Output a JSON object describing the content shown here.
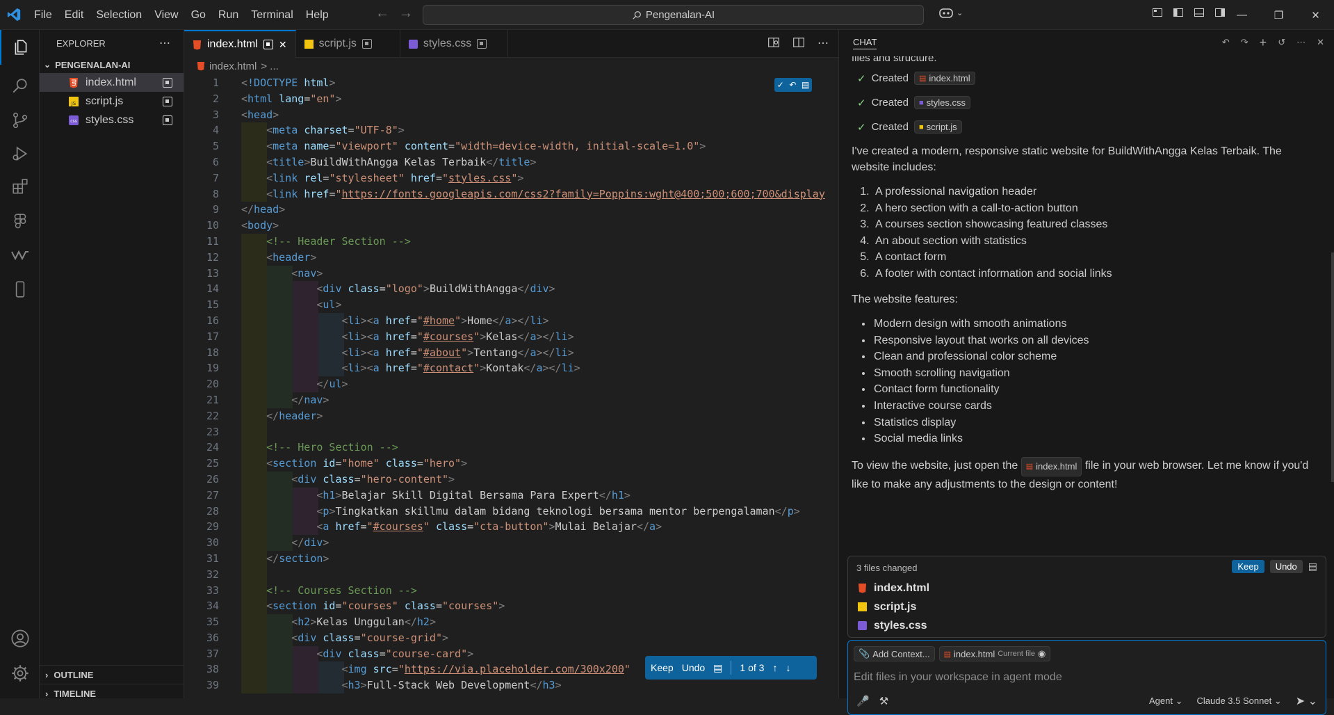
{
  "menu": [
    "File",
    "Edit",
    "Selection",
    "View",
    "Go",
    "Run",
    "Terminal",
    "Help"
  ],
  "search": {
    "text": "Pengenalan-AI"
  },
  "sidebar": {
    "title": "EXPLORER",
    "folder": "PENGENALAN-AI",
    "files": [
      {
        "name": "index.html",
        "icon": "html-file-icon"
      },
      {
        "name": "script.js",
        "icon": "js-file-icon"
      },
      {
        "name": "styles.css",
        "icon": "css-file-icon"
      }
    ],
    "outline": "OUTLINE",
    "timeline": "TIMELINE"
  },
  "tabs": [
    "index.html",
    "script.js",
    "styles.css"
  ],
  "breadcrumb": {
    "file": "index.html",
    "rest": "> ..."
  },
  "review": {
    "keep": "Keep",
    "undo": "Undo",
    "count": "1 of 3"
  },
  "chat": {
    "title": "CHAT",
    "fragment": "files and structure.",
    "created_label": "Created",
    "created_files": [
      "index.html",
      "styles.css",
      "script.js"
    ],
    "intro": "I've created a modern, responsive static website for BuildWithAngga Kelas Terbaik. The website includes:",
    "includes": [
      "A professional navigation header",
      "A hero section with a call-to-action button",
      "A courses section showcasing featured classes",
      "An about section with statistics",
      "A contact form",
      "A footer with contact information and social links"
    ],
    "features_title": "The website features:",
    "features": [
      "Modern design with smooth animations",
      "Responsive layout that works on all devices",
      "Clean and professional color scheme",
      "Smooth scrolling navigation",
      "Contact form functionality",
      "Interactive course cards",
      "Statistics display",
      "Social media links"
    ],
    "view_before": "To view the website, just open the",
    "view_chip": "index.html",
    "view_after": "file in your web browser. Let me know if you'd like to make any adjustments to the design or content!",
    "changed": {
      "label": "3 files changed",
      "keep": "Keep",
      "undo": "Undo",
      "files": [
        "index.html",
        "script.js",
        "styles.css"
      ]
    },
    "input": {
      "add_context": "Add Context...",
      "current_file": "index.html",
      "current_file_tag": "Current file",
      "placeholder": "Edit files in your workspace in agent mode",
      "mode": "Agent",
      "model": "Claude 3.5 Sonnet"
    }
  }
}
